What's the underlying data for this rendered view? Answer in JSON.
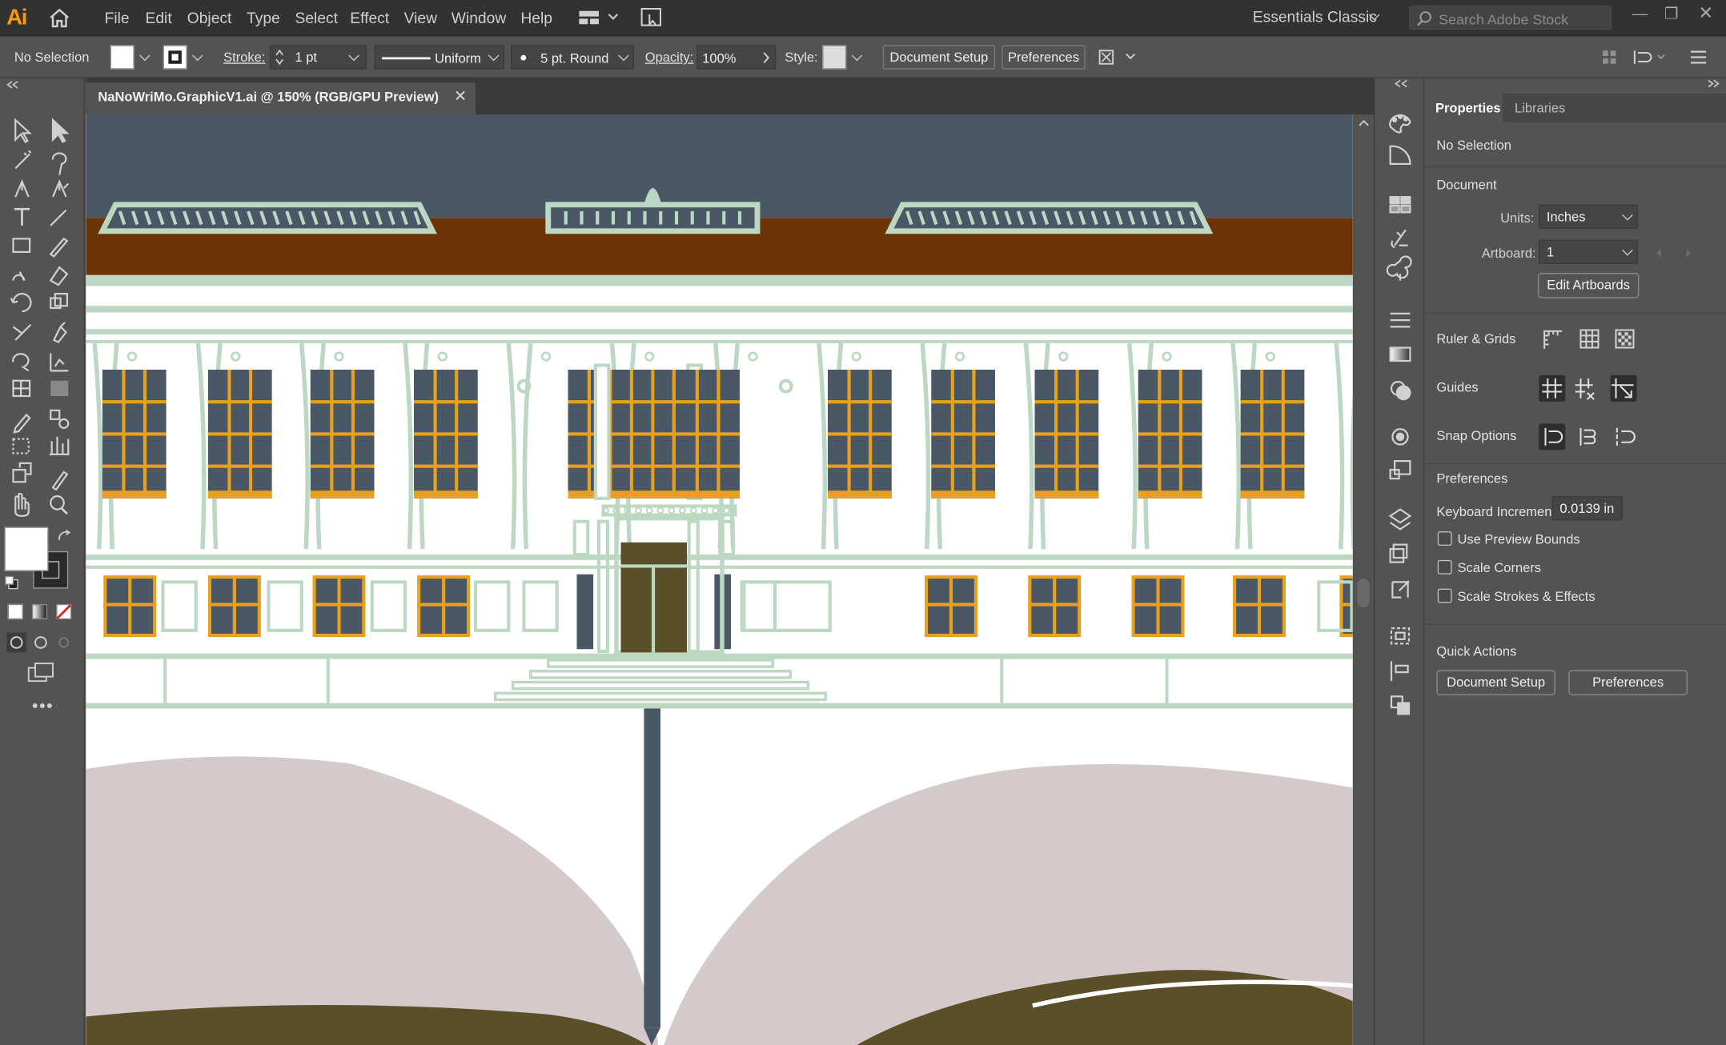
{
  "app": {
    "logo": "Ai"
  },
  "menu": [
    "File",
    "Edit",
    "Object",
    "Type",
    "Select",
    "Effect",
    "View",
    "Window",
    "Help"
  ],
  "workspace": {
    "label": "Essentials Classic"
  },
  "search": {
    "placeholder": "Search Adobe Stock"
  },
  "control_bar": {
    "selection": "No Selection",
    "stroke_label": "Stroke:",
    "stroke_weight": "1 pt",
    "profile": "Uniform",
    "brush": "5 pt. Round",
    "opacity_label": "Opacity:",
    "opacity_value": "100%",
    "style_label": "Style:",
    "document_setup": "Document Setup",
    "preferences": "Preferences"
  },
  "document": {
    "tab_title": "NaNoWriMo.GraphicV1.ai @ 150% (RGB/GPU Preview)"
  },
  "properties": {
    "tabs": [
      "Properties",
      "Libraries"
    ],
    "selection": "No Selection",
    "document_heading": "Document",
    "units_label": "Units:",
    "units_value": "Inches",
    "artboard_label": "Artboard:",
    "artboard_value": "1",
    "edit_artboards": "Edit Artboards",
    "ruler_grids": "Ruler & Grids",
    "guides": "Guides",
    "snap_options": "Snap Options",
    "preferences_heading": "Preferences",
    "keyboard_increment_label": "Keyboard Increment:",
    "keyboard_increment_value": "0.0139 in",
    "checkboxes": [
      "Use Preview Bounds",
      "Scale Corners",
      "Scale Strokes & Effects"
    ],
    "quick_actions_heading": "Quick Actions",
    "qa_document_setup": "Document Setup",
    "qa_preferences": "Preferences"
  },
  "colors": {
    "sky": "#4a5866",
    "roof": "#6b3306",
    "trim": "#bcd8c2",
    "window_frame": "#e8a11f",
    "window_glass": "#4a5866",
    "door": "#5b4f2a",
    "book_page": "#d5cacb"
  }
}
